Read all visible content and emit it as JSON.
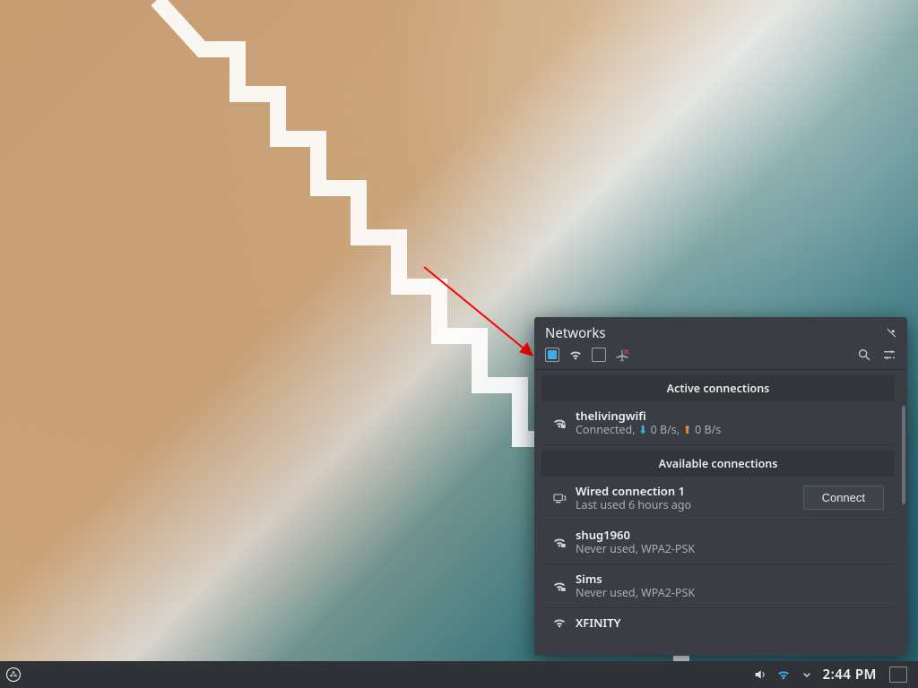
{
  "popup": {
    "title": "Networks",
    "toolbar": {
      "enable_networking_checked": true,
      "wifi_enabled": true,
      "mobile_broadband_checked": false,
      "airplane_label": "airplane-mode"
    },
    "sections": {
      "active": "Active connections",
      "available": "Available connections"
    },
    "active": {
      "name": "thelivingwifi",
      "status_prefix": "Connected, ",
      "down_rate": "0 B/s",
      "up_rate": "0 B/s"
    },
    "available": [
      {
        "name": "Wired connection 1",
        "sub": "Last used 6 hours ago",
        "button": "Connect",
        "type": "wired"
      },
      {
        "name": "shug1960",
        "sub": "Never used, WPA2-PSK",
        "type": "wifi-lock"
      },
      {
        "name": "Sims",
        "sub": "Never used, WPA2-PSK",
        "type": "wifi-lock"
      },
      {
        "name": "XFINITY",
        "sub": "",
        "type": "wifi"
      }
    ]
  },
  "taskbar": {
    "clock": "2:44 PM"
  },
  "colors": {
    "accent": "#3daee9",
    "panel": "#3a3e44",
    "arrow": "#ff0000"
  }
}
